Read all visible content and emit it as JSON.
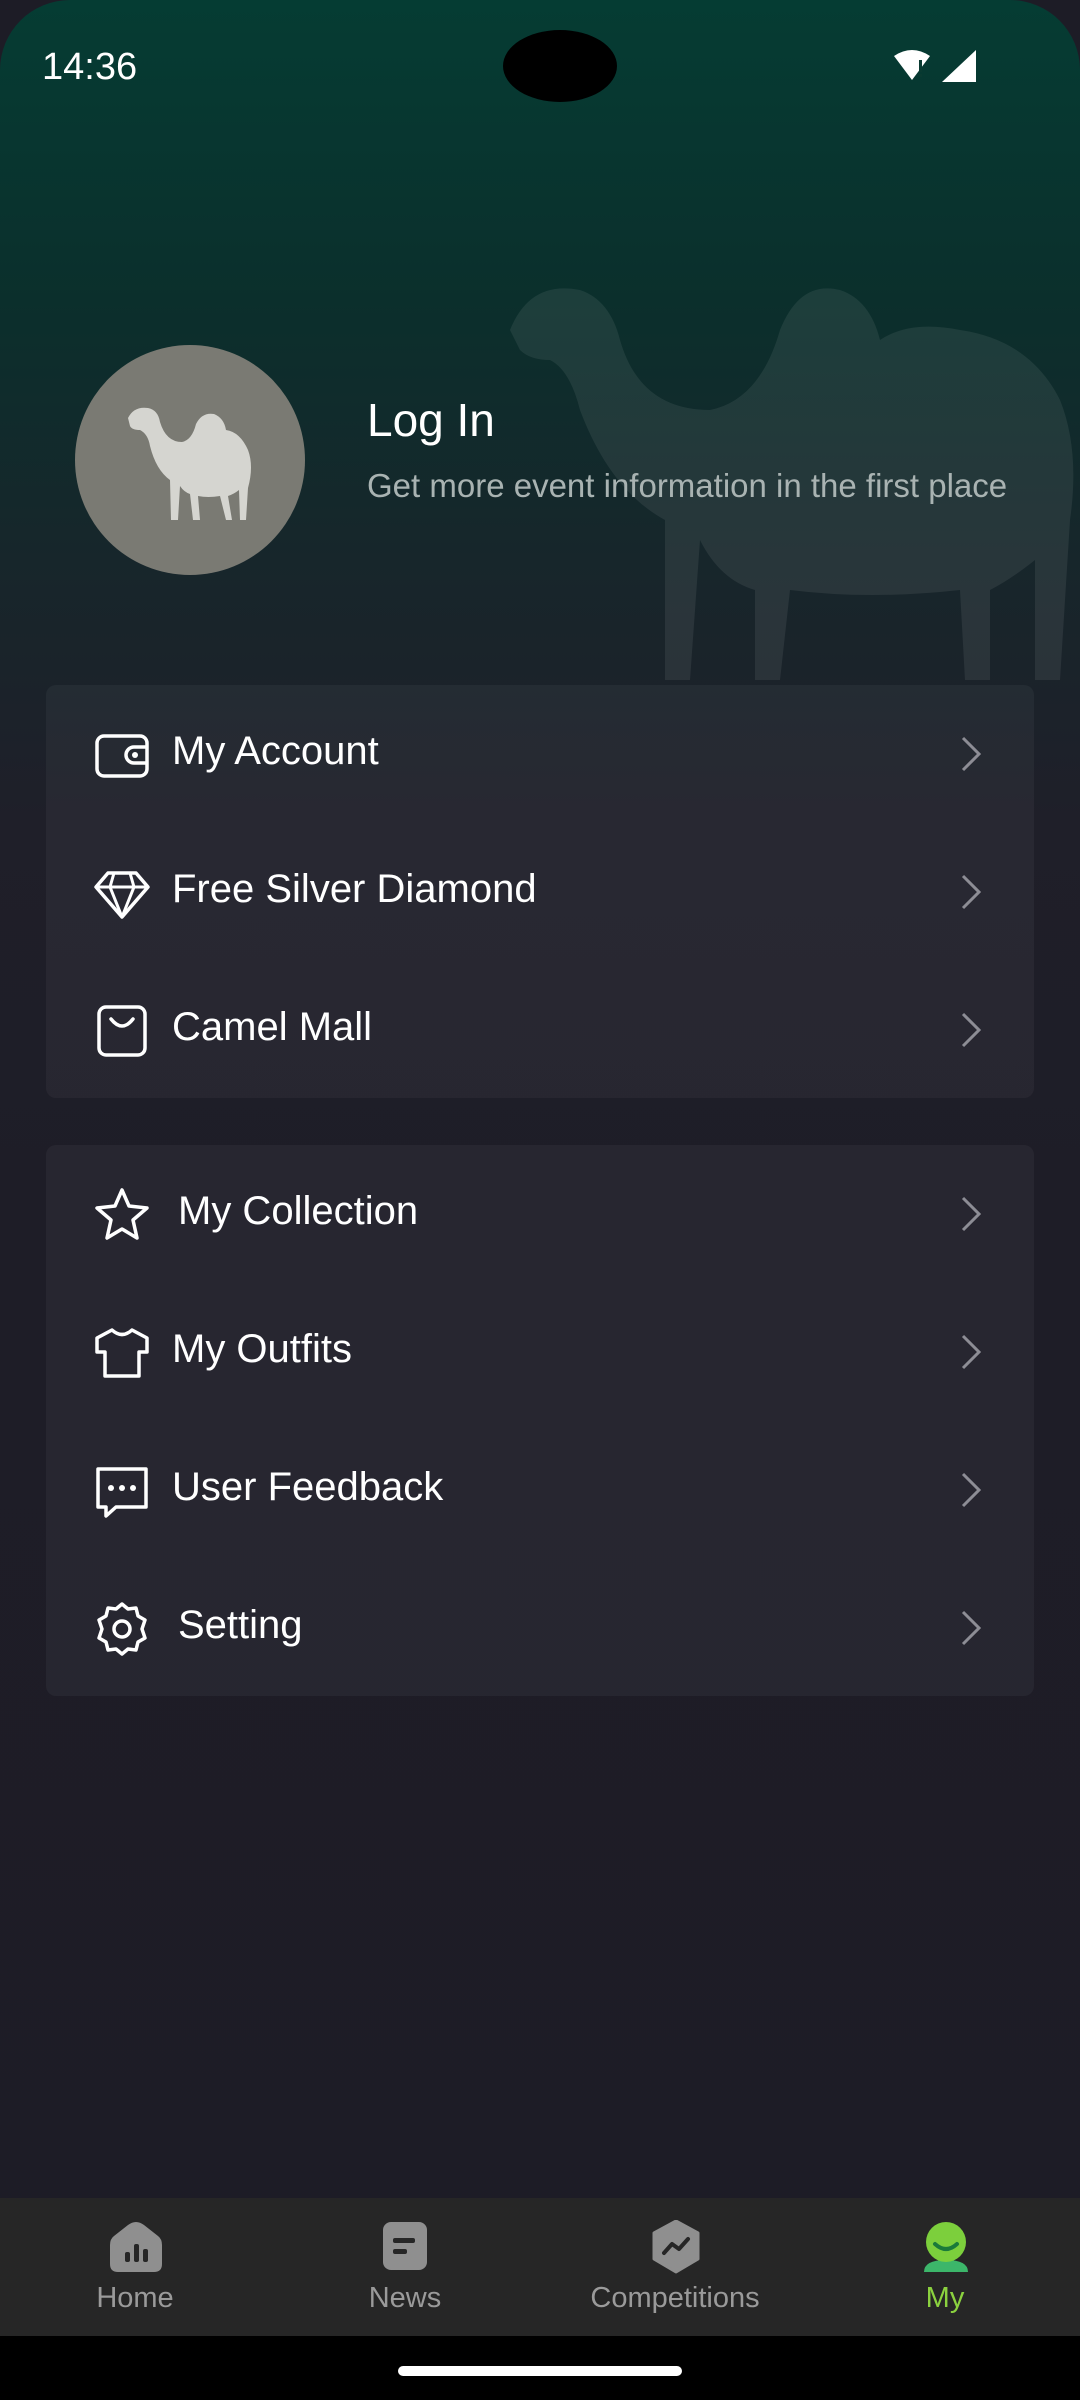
{
  "status_bar": {
    "time": "14:36"
  },
  "profile": {
    "title": "Log In",
    "subtitle": "Get more event information in the first place"
  },
  "menu_group_1": [
    {
      "label": "My Account",
      "icon": "wallet-icon"
    },
    {
      "label": "Free Silver Diamond",
      "icon": "diamond-icon"
    },
    {
      "label": "Camel Mall",
      "icon": "shopping-bag-icon"
    }
  ],
  "menu_group_2": [
    {
      "label": "My Collection",
      "icon": "star-icon"
    },
    {
      "label": "My Outfits",
      "icon": "tshirt-icon"
    },
    {
      "label": "User Feedback",
      "icon": "chat-bubble-icon"
    },
    {
      "label": "Setting",
      "icon": "gear-icon"
    }
  ],
  "tabs": [
    {
      "label": "Home",
      "icon": "home-chart-icon",
      "active": false
    },
    {
      "label": "News",
      "icon": "news-icon",
      "active": false
    },
    {
      "label": "Competitions",
      "icon": "competitions-icon",
      "active": false
    },
    {
      "label": "My",
      "icon": "profile-icon",
      "active": true
    }
  ],
  "colors": {
    "accent_green": "#8bd13f",
    "background": "#1d1c26",
    "header_green": "#053c33",
    "avatar_gray": "#7a7a73"
  }
}
